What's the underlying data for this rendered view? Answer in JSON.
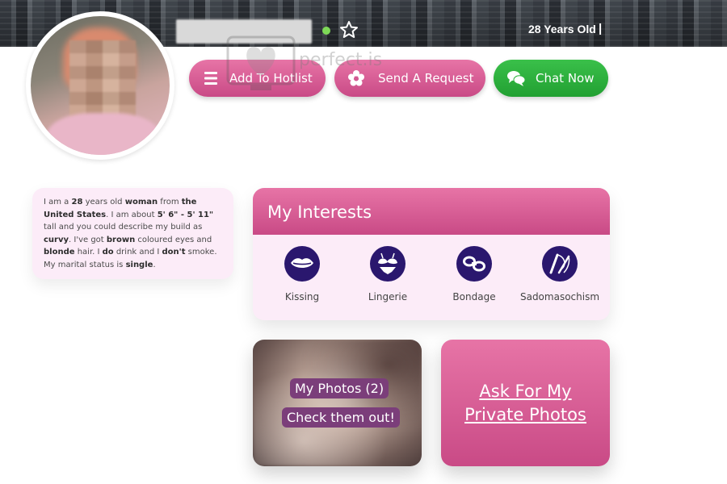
{
  "header": {
    "age_text": "28 Years Old",
    "separator": "|",
    "online_color": "#7ed957"
  },
  "actions": {
    "hotlist_label": "Add To Hotlist",
    "request_label": "Send A Request",
    "chat_label": "Chat Now"
  },
  "watermark": {
    "text": "perfect.is"
  },
  "bio": {
    "segments": [
      {
        "t": "I am a ",
        "b": false
      },
      {
        "t": "28",
        "b": true
      },
      {
        "t": " years old ",
        "b": false
      },
      {
        "t": "woman",
        "b": true
      },
      {
        "t": " from ",
        "b": false
      },
      {
        "t": "the United States",
        "b": true
      },
      {
        "t": ". I am about ",
        "b": false
      },
      {
        "t": "5' 6\" - 5' 11\"",
        "b": true
      },
      {
        "t": " tall and you could describe my build as ",
        "b": false
      },
      {
        "t": "curvy",
        "b": true
      },
      {
        "t": ". I've got ",
        "b": false
      },
      {
        "t": "brown",
        "b": true
      },
      {
        "t": " coloured eyes and ",
        "b": false
      },
      {
        "t": "blonde",
        "b": true
      },
      {
        "t": " hair. I ",
        "b": false
      },
      {
        "t": "do",
        "b": true
      },
      {
        "t": " drink and I ",
        "b": false
      },
      {
        "t": "don't",
        "b": true
      },
      {
        "t": " smoke. My marital status is ",
        "b": false
      },
      {
        "t": "single",
        "b": true
      },
      {
        "t": ".",
        "b": false
      }
    ]
  },
  "interests": {
    "title": "My Interests",
    "items": [
      {
        "label": "Kissing",
        "icon": "lips-icon"
      },
      {
        "label": "Lingerie",
        "icon": "lingerie-icon"
      },
      {
        "label": "Bondage",
        "icon": "handcuffs-icon"
      },
      {
        "label": "Sadomasochism",
        "icon": "whip-icon"
      }
    ]
  },
  "photos": {
    "count_label": "My Photos (2)",
    "cta_label": "Check them out!"
  },
  "private": {
    "line1": "Ask For My",
    "line2": "Private Photos"
  },
  "colors": {
    "pink_top": "#e774a6",
    "pink_bottom": "#c94a86",
    "green": "#2db33d",
    "interest_icon_bg": "#2a176e",
    "card_bg": "#fcecf8"
  }
}
